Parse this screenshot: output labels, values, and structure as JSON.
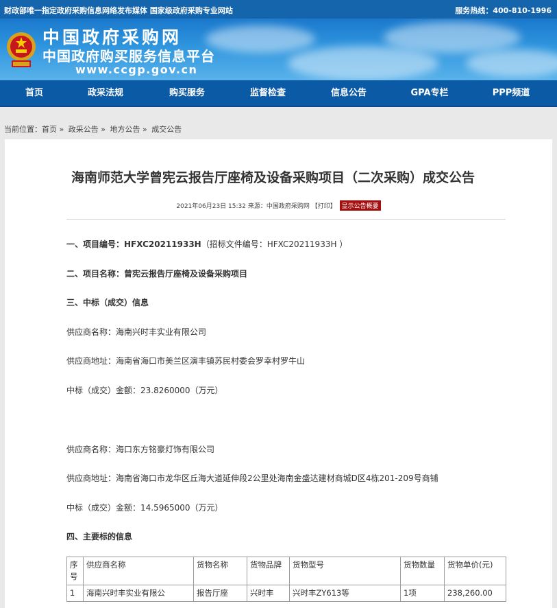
{
  "topbar": {
    "left": "财政部唯一指定政府采购信息网络发布媒体 国家级政府采购专业网站",
    "right": "服务热线：400-810-1996"
  },
  "banner": {
    "title": "中国政府采购网",
    "subtitle": "中国政府购买服务信息平台",
    "url": "www.ccgp.gov.cn"
  },
  "nav": [
    "首页",
    "政采法规",
    "购买服务",
    "监督检查",
    "信息公告",
    "GPA专栏",
    "PPP频道"
  ],
  "breadcrumb": [
    "当前位置：首页 »",
    "政采公告 »",
    "地方公告 »",
    "成交公告"
  ],
  "article": {
    "title": "海南师范大学曾宪云报告厅座椅及设备采购项目（二次采购）成交公告",
    "meta": "2021年06月23日 15:32 来源：中国政府采购网 【打印】",
    "show_summary": "显示公告概要",
    "item1_label": "一、项目编号：",
    "item1_value": "HFXC20211933H",
    "item1_note": "（招标文件编号：HFXC20211933H ）",
    "item2": "二、项目名称：曾宪云报告厅座椅及设备采购项目",
    "item3": "三、中标（成交）信息",
    "s1_name": "供应商名称：海南兴时丰实业有限公司",
    "s1_addr": "供应商地址：海南省海口市美兰区演丰镇苏民村委会罗幸村罗牛山",
    "s1_amount": "中标（成交）金额：23.8260000（万元）",
    "s2_name": "供应商名称：海口东方铭豪灯饰有限公司",
    "s2_addr": "供应商地址：海南省海口市龙华区丘海大道延伸段2公里处海南金盛达建材商城D区4栋201-209号商铺",
    "s2_amount": "中标（成交）金额：14.5965000（万元）",
    "item4": "四、主要标的信息"
  },
  "table": {
    "headers": [
      "序号",
      "供应商名称",
      "货物名称",
      "货物品牌",
      "货物型号",
      "货物数量",
      "货物单价(元)"
    ],
    "rows": [
      [
        "1",
        "海南兴时丰实业有限公",
        "报告厅座",
        "兴时丰",
        "兴时丰ZY613等",
        "1项",
        "238,260.00"
      ]
    ]
  },
  "colors": {
    "topbar": "#1565ad",
    "nav": "#0b5aa6",
    "badge": "#a30f0f"
  }
}
